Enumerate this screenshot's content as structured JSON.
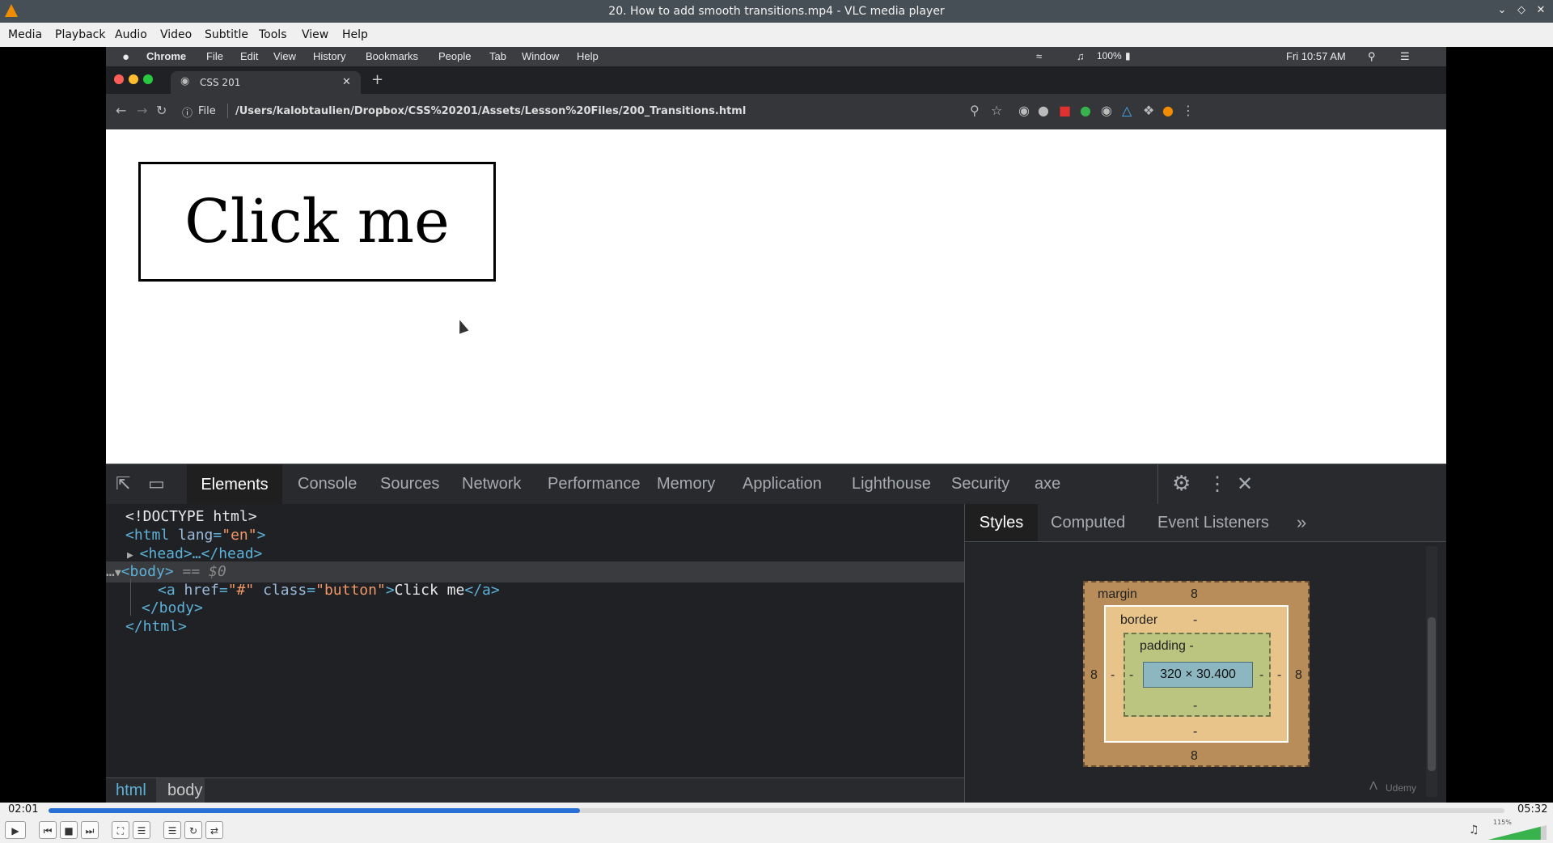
{
  "vlc": {
    "window_title": "20. How to add smooth transitions.mp4 - VLC media player",
    "menu": [
      "Media",
      "Playback",
      "Audio",
      "Video",
      "Subtitle",
      "Tools",
      "View",
      "Help"
    ],
    "time_elapsed": "02:01",
    "time_total": "05:32",
    "progress_fraction": 0.365,
    "volume_label": "115%",
    "volume_fraction": 0.9,
    "colors": {
      "progress": "#2a6fd6",
      "volume": "#37b24d"
    }
  },
  "mac_menu": {
    "items": [
      "Chrome",
      "File",
      "Edit",
      "View",
      "History",
      "Bookmarks",
      "People",
      "Tab",
      "Window",
      "Help"
    ],
    "battery": "100%",
    "clock": "Fri 10:57 AM"
  },
  "chrome": {
    "tab_title": "CSS 201",
    "url_scheme": "File",
    "url": "/Users/kalobtaulien/Dropbox/CSS%20201/Assets/Lesson%20Files/200_Transitions.html"
  },
  "page": {
    "button_text": "Click me"
  },
  "devtools": {
    "tabs": [
      "Elements",
      "Console",
      "Sources",
      "Network",
      "Performance",
      "Memory",
      "Application",
      "Lighthouse",
      "Security",
      "axe"
    ],
    "active_tab": "Elements",
    "dom": {
      "doctype": "<!DOCTYPE html>",
      "html_open_tag": "<html ",
      "html_attr": "lang",
      "html_attr_val": "\"en\"",
      "html_close_bracket": ">",
      "head": "<head>…</head>",
      "body_open": "<body>",
      "selected_marker": "== $0",
      "a_open": "<a ",
      "a_attr1": "href",
      "a_val1": "\"#\"",
      "a_attr2": "class",
      "a_val2": "\"button\"",
      "a_close_bracket": ">",
      "a_text": "Click me",
      "a_close": "</a>",
      "body_close": "</body>",
      "html_close": "</html>"
    },
    "breadcrumbs": [
      "html",
      "body"
    ],
    "styles_tabs": [
      "Styles",
      "Computed",
      "Event Listeners"
    ],
    "box_model": {
      "margin_label": "margin",
      "margin_top": "8",
      "margin_bottom": "8",
      "margin_left": "8",
      "margin_right": "8",
      "border_label": "border",
      "border_dash": "-",
      "padding_label": "padding -",
      "dash": "-",
      "content_size": "320 × 30.400"
    },
    "watermark": "Udemy"
  }
}
